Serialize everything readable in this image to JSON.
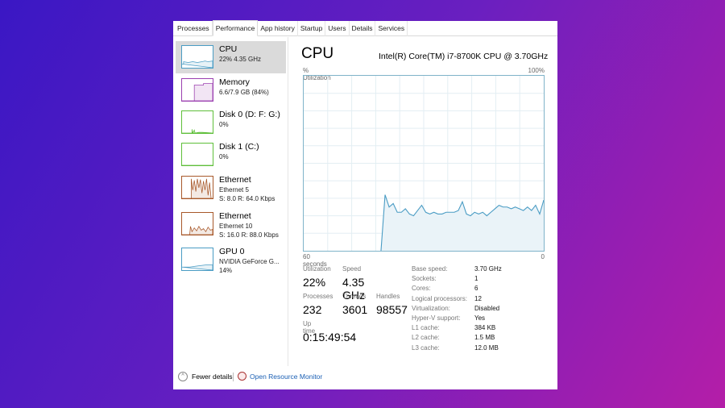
{
  "tabs": [
    "Processes",
    "Performance",
    "App history",
    "Startup",
    "Users",
    "Details",
    "Services"
  ],
  "active_tab": "Performance",
  "sidebar": [
    {
      "name": "CPU",
      "sub1": "22% 4.35 GHz",
      "color": "#4a9cc4"
    },
    {
      "name": "Memory",
      "sub1": "6.6/7.9 GB (84%)",
      "color": "#9b3fb0"
    },
    {
      "name": "Disk 0 (D: F: G:)",
      "sub1": "0%",
      "color": "#5fbf3a"
    },
    {
      "name": "Disk 1 (C:)",
      "sub1": "0%",
      "color": "#5fbf3a"
    },
    {
      "name": "Ethernet",
      "sub1": "Ethernet 5",
      "sub2": "S: 8.0 R: 64.0 Kbps",
      "color": "#a8582a"
    },
    {
      "name": "Ethernet",
      "sub1": "Ethernet 10",
      "sub2": "S: 16.0 R: 88.0 Kbps",
      "color": "#a8582a"
    },
    {
      "name": "GPU 0",
      "sub1": "NVIDIA GeForce G...",
      "sub2": "14%",
      "color": "#4a9cc4"
    }
  ],
  "main": {
    "title": "CPU",
    "model": "Intel(R) Core(TM) i7-8700K CPU @ 3.70GHz",
    "y_label": "% Utilization",
    "y_max_label": "100%",
    "x_left_label": "60 seconds",
    "x_right_label": "0",
    "stats": {
      "utilization_label": "Utilization",
      "utilization": "22%",
      "speed_label": "Speed",
      "speed": "4.35 GHz",
      "processes_label": "Processes",
      "processes": "232",
      "threads_label": "Threads",
      "threads": "3601",
      "handles_label": "Handles",
      "handles": "98557",
      "uptime_label": "Up time",
      "uptime": "0:15:49:54"
    },
    "specs": [
      [
        "Base speed:",
        "3.70 GHz"
      ],
      [
        "Sockets:",
        "1"
      ],
      [
        "Cores:",
        "6"
      ],
      [
        "Logical processors:",
        "12"
      ],
      [
        "Virtualization:",
        "Disabled"
      ],
      [
        "Hyper-V support:",
        "Yes"
      ],
      [
        "L1 cache:",
        "384 KB"
      ],
      [
        "L2 cache:",
        "1.5 MB"
      ],
      [
        "L3 cache:",
        "12.0 MB"
      ]
    ]
  },
  "chart_data": {
    "type": "area",
    "xlabel": "60 seconds",
    "ylabel": "% Utilization",
    "ylim": [
      0,
      100
    ],
    "xlim": [
      60,
      0
    ],
    "grid": true,
    "color": "#4a9cc4",
    "values": [
      null,
      null,
      null,
      null,
      null,
      null,
      null,
      null,
      null,
      null,
      null,
      null,
      null,
      null,
      null,
      null,
      null,
      null,
      null,
      0,
      32,
      25,
      27,
      22,
      22,
      24,
      21,
      20,
      23,
      26,
      22,
      21,
      22,
      21,
      21,
      22,
      22,
      22,
      23,
      28,
      21,
      20,
      22,
      21,
      22,
      20,
      22,
      24,
      26,
      25,
      25,
      24,
      25,
      24,
      23,
      25,
      23,
      26,
      21,
      29
    ]
  },
  "footer": {
    "fewer": "Fewer details",
    "monitor": "Open Resource Monitor"
  }
}
